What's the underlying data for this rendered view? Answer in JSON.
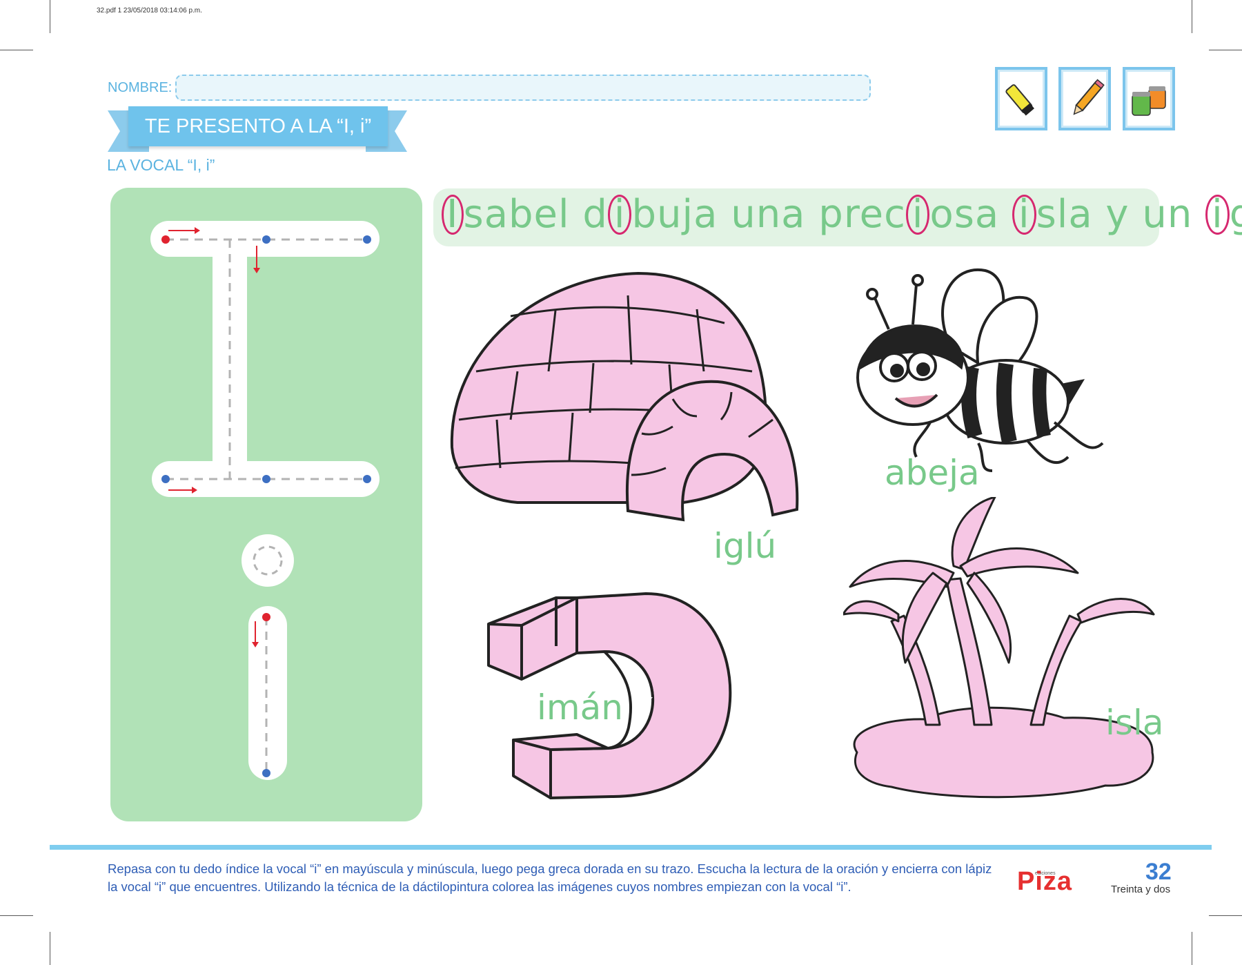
{
  "print_info": "32.pdf   1   23/05/2018   03:14:06 p.m.",
  "header": {
    "nombre_label": "NOMBRE:",
    "title": "TE PRESENTO A LA “I, i”",
    "subtitle": "LA VOCAL “I, i”"
  },
  "tools": [
    "glue-stick-icon",
    "pencil-icon",
    "paint-jars-icon"
  ],
  "sentence": {
    "letter_1": "I",
    "part_1": "sabel d",
    "letter_2": "i",
    "part_2": "buja una prec",
    "letter_3": "i",
    "part_3": "osa ",
    "letter_4": "i",
    "part_4": "sla y un ",
    "letter_5": "i",
    "part_5": "glú."
  },
  "words": {
    "iglu": "iglú",
    "abeja": "abeja",
    "iman": "imán",
    "isla": "isla"
  },
  "footer": {
    "instructions": "Repasa con tu dedo índice la vocal “i” en mayúscula y minúscula, luego pega greca dorada en su trazo. Escucha la lectura de la oración y encierra con lápiz la vocal “i” que encuentres. Utilizando la técnica de la dáctilopintura colorea las imágenes cuyos nombres empiezan con la vocal “i”.",
    "logo_small": "ediciones",
    "logo": "Piza",
    "page_number": "32",
    "page_word": "Treinta y dos"
  },
  "colors": {
    "accent_blue": "#6fc3ec",
    "panel_green": "#b1e2b7",
    "word_green": "#78c98a",
    "circle_magenta": "#d6286f",
    "coloring_pink": "#f6c6e4"
  }
}
